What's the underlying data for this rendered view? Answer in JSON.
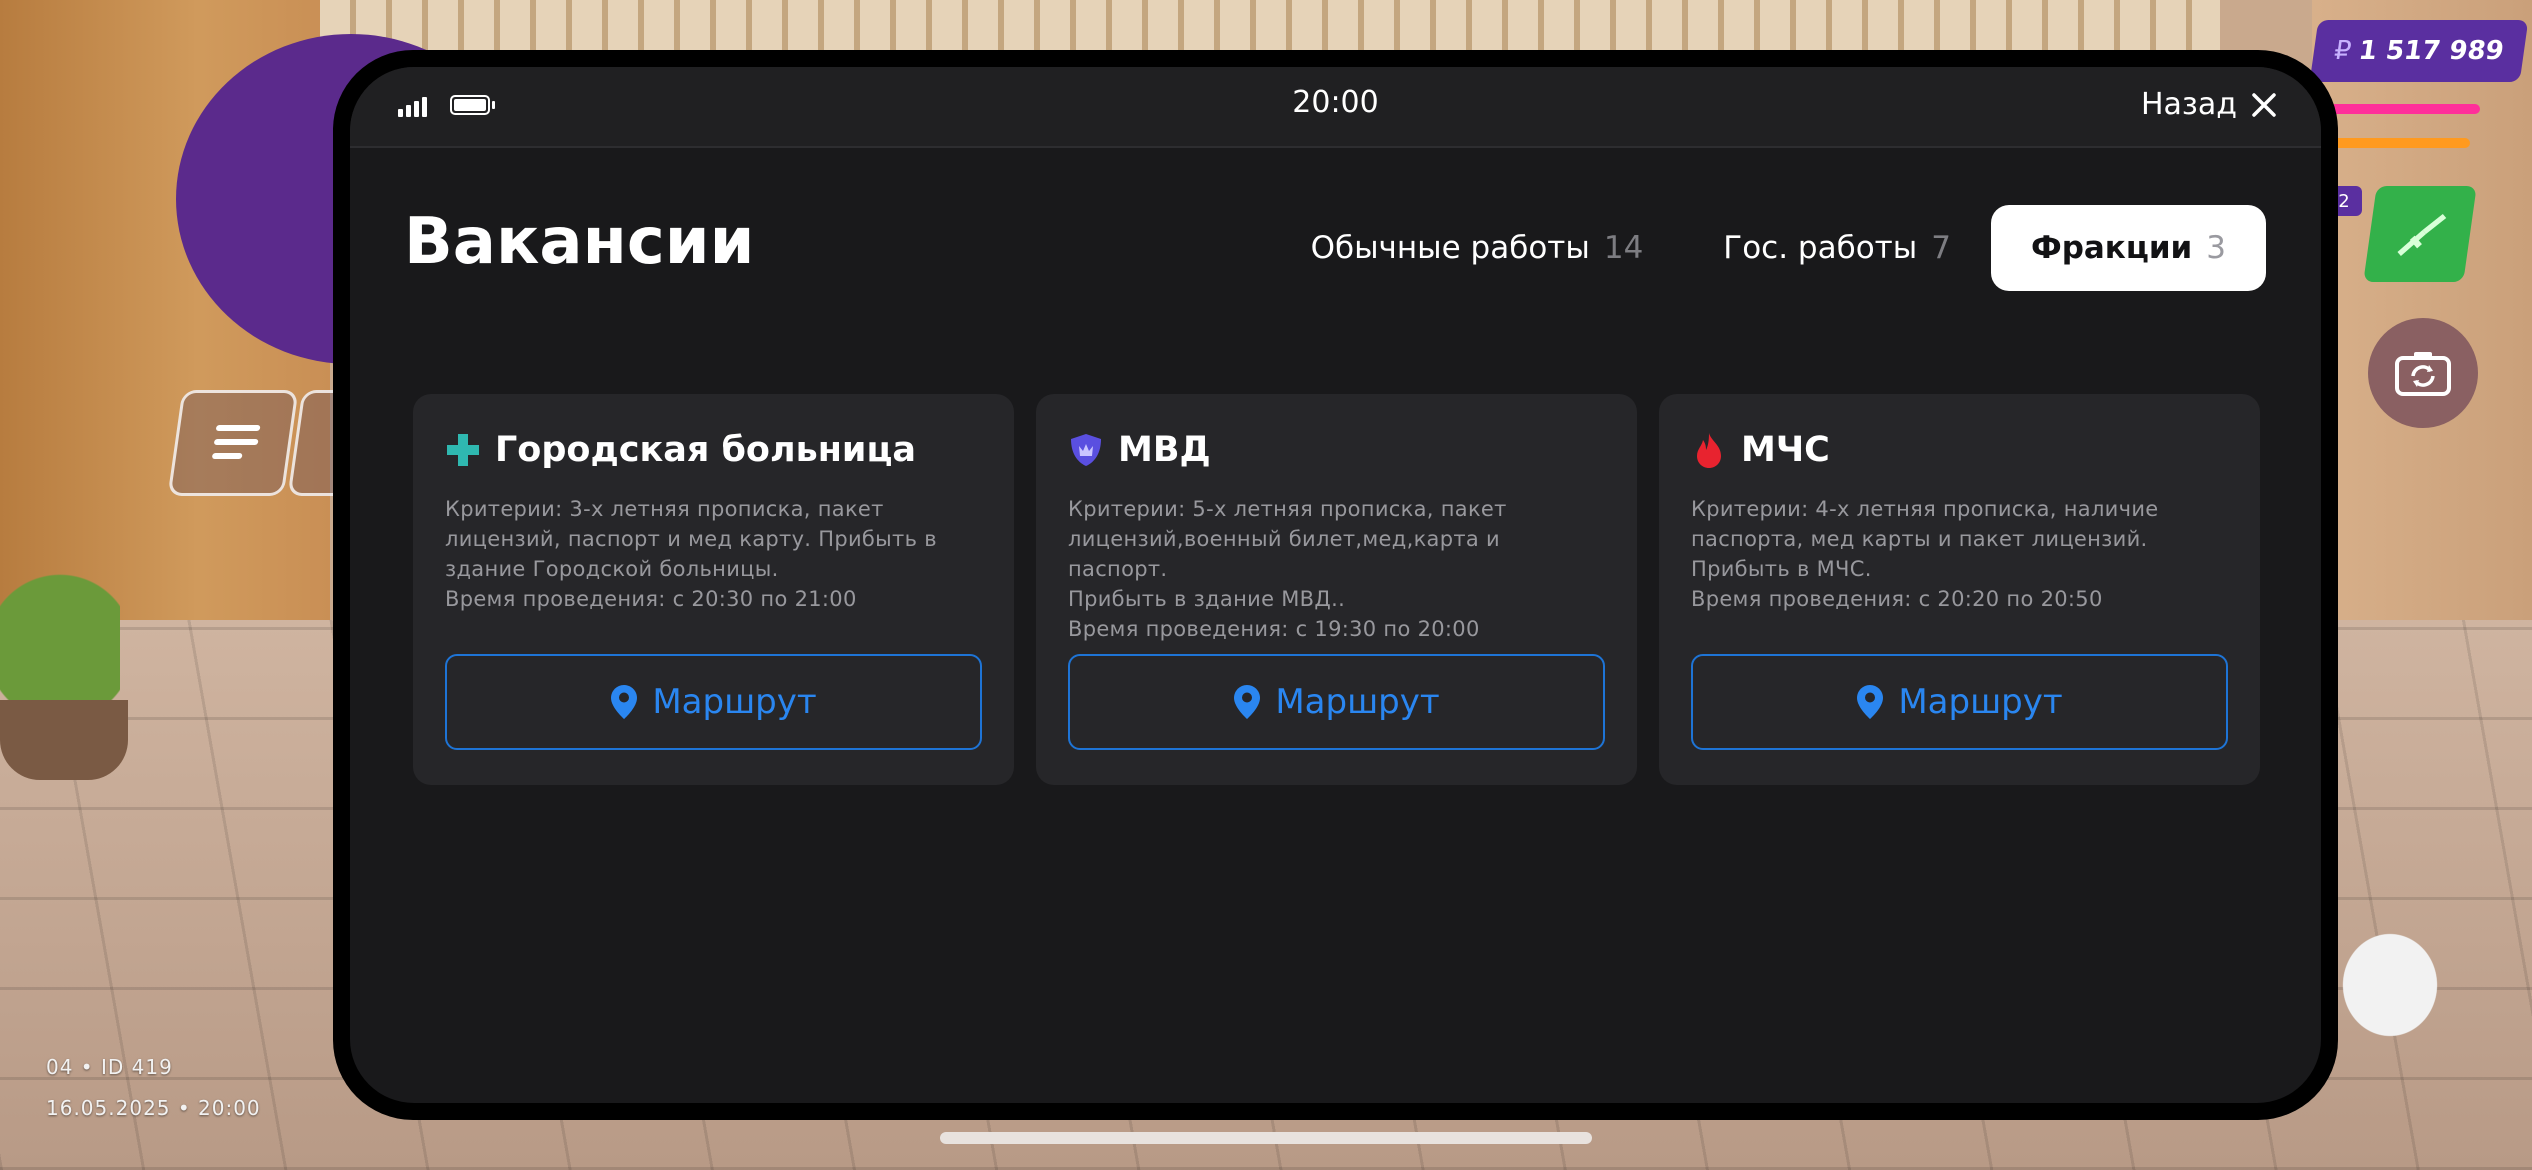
{
  "game_hud": {
    "money_symbol": "₽",
    "money_value": "1 517 989",
    "level_badge": "2",
    "server_line": "04 • ID 419",
    "datetime_line": "16.05.2025 • 20:00"
  },
  "phone": {
    "status_time": "20:00",
    "back_label": "Назад",
    "page_title": "Вакансии",
    "tabs": [
      {
        "label": "Обычные работы",
        "count": "14",
        "active": false
      },
      {
        "label": "Гос. работы",
        "count": "7",
        "active": false
      },
      {
        "label": "Фракции",
        "count": "3",
        "active": true
      }
    ],
    "cards": [
      {
        "title": "Городская больница",
        "icon": "medical-cross-icon",
        "icon_color": "#2fb8b0",
        "description": "Критерии: 3-х летняя прописка, пакет\nлицензий, паспорт и мед карту. Прибыть в\nздание Городской больницы.\nВремя проведения: с 20:30 по 21:00",
        "button_label": "Маршрут"
      },
      {
        "title": "МВД",
        "icon": "police-shield-icon",
        "icon_color": "#5a4fe0",
        "description": "Критерии: 5-х летняя прописка, пакет\nлицензий,военный билет,мед,карта и паспорт.\nПрибыть в здание МВД..\nВремя проведения: с 19:30 по 20:00",
        "button_label": "Маршрут"
      },
      {
        "title": "МЧС",
        "icon": "fire-icon",
        "icon_color": "#e8232f",
        "description": "Критерии: 4-х летняя прописка, наличие\nпаспорта, мед карты и пакет лицензий.\nПрибыть в МЧС.\nВремя проведения: с 20:20 по 20:50",
        "button_label": "Маршрут"
      }
    ]
  },
  "colors": {
    "accent_blue": "#2a86f0",
    "screen_bg": "#19191b",
    "card_bg": "#262629",
    "hud_purple": "#5a2fa0",
    "weapon_green": "#33b14a"
  }
}
